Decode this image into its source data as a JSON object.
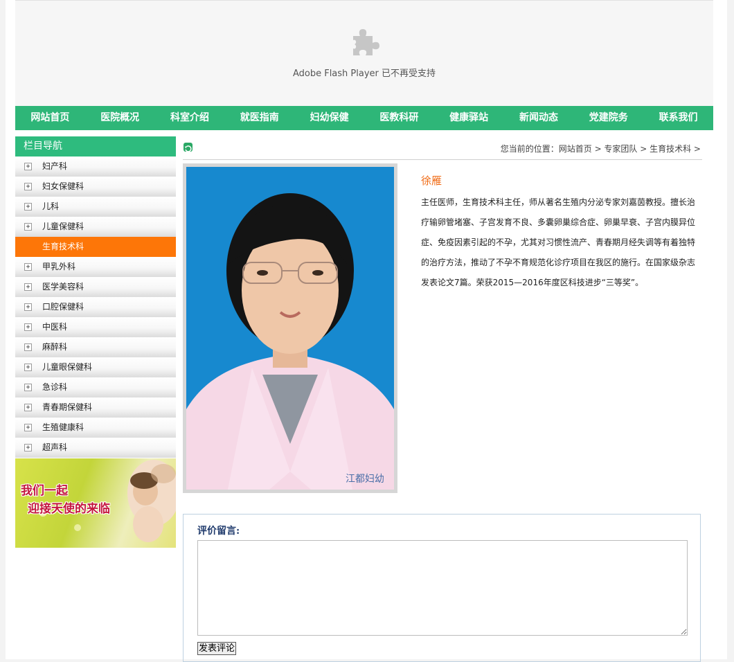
{
  "flash": {
    "icon": "puzzle-icon",
    "message": "Adobe Flash Player 已不再受支持"
  },
  "nav": {
    "items": [
      "网站首页",
      "医院概况",
      "科室介绍",
      "就医指南",
      "妇幼保健",
      "医教科研",
      "健康驿站",
      "新闻动态",
      "党建院务",
      "联系我们"
    ]
  },
  "sidebar": {
    "title": "栏目导航",
    "items": [
      {
        "label": "妇产科"
      },
      {
        "label": "妇女保健科"
      },
      {
        "label": "儿科"
      },
      {
        "label": "儿童保健科"
      },
      {
        "label": "生育技术科",
        "active": true
      },
      {
        "label": "甲乳外科"
      },
      {
        "label": "医学美容科"
      },
      {
        "label": "口腔保健科"
      },
      {
        "label": "中医科"
      },
      {
        "label": "麻醉科"
      },
      {
        "label": "儿童眼保健科"
      },
      {
        "label": "急诊科"
      },
      {
        "label": "青春期保健科"
      },
      {
        "label": "生殖健康科"
      },
      {
        "label": "超声科"
      }
    ],
    "banner": {
      "line1": "我们一起",
      "line2": "迎接天使的来临"
    }
  },
  "breadcrumb": {
    "text": "您当前的位置：网站首页 > 专家团队 > 生育技术科 >"
  },
  "doctor": {
    "name": "徐雁",
    "description": "主任医师，生育技术科主任，师从著名生殖内分泌专家刘嘉茵教授。擅长治疗输卵管堵塞、子宫发育不良、多囊卵巢综合症、卵巢早衰、子宫内膜异位症、免疫因素引起的不孕，尤其对习惯性流产、青春期月经失调等有着独特的治疗方法，推动了不孕不育规范化诊疗项目在我区的施行。在国家级杂志发表论文7篇。荣获2015—2016年度区科技进步“三等奖”。"
  },
  "comment": {
    "label": "评价留言:",
    "value": "",
    "submit_label": "发表评论"
  },
  "colors": {
    "nav_green": "#2eb678",
    "active_orange": "#fd7608",
    "name_orange": "#f06b15"
  }
}
